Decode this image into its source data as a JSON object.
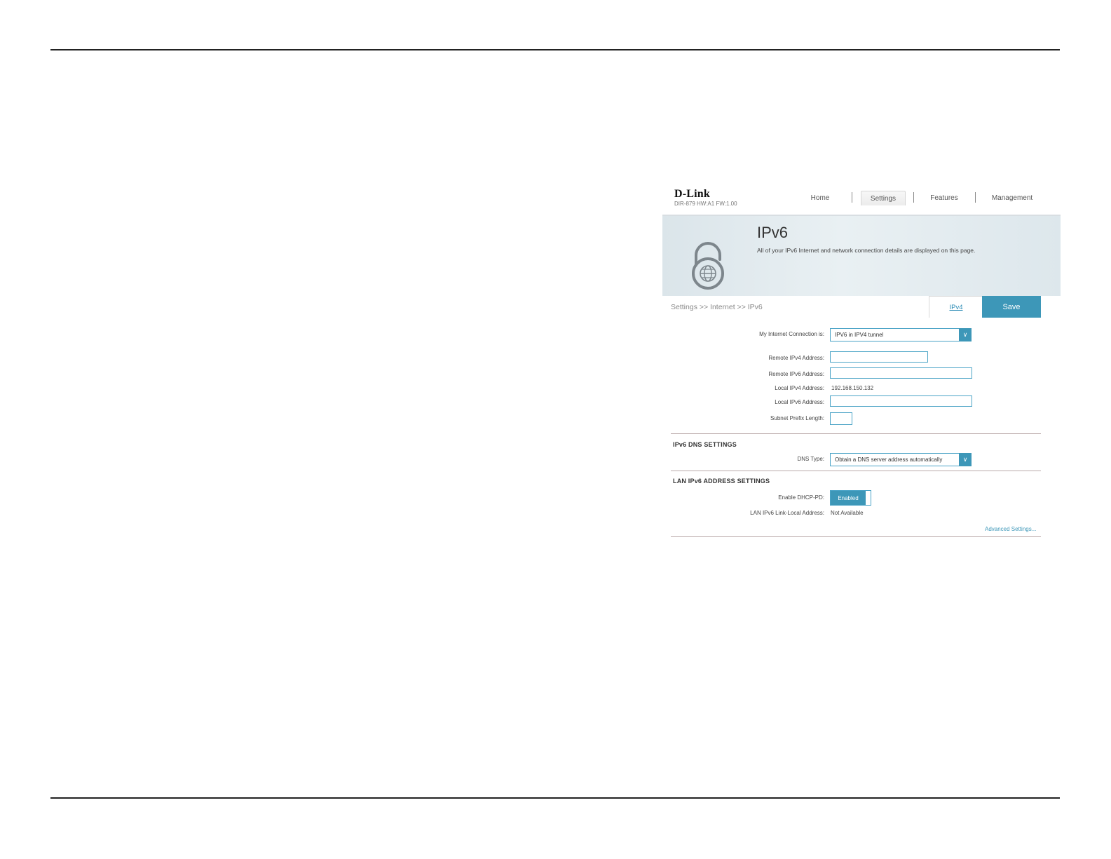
{
  "header": {
    "logo": "D-Link",
    "model": "DIR-879 HW:A1 FW:1.00",
    "nav": [
      {
        "label": "Home",
        "active": false
      },
      {
        "label": "Settings",
        "active": true
      },
      {
        "label": "Features",
        "active": false
      },
      {
        "label": "Management",
        "active": false
      }
    ]
  },
  "banner": {
    "title": "IPv6",
    "description": "All of your IPv6 Internet and network connection details are displayed on this page.",
    "icon": "ipv6-lock-globe-icon"
  },
  "subheader": {
    "breadcrumb": "Settings >> Internet >> IPv6",
    "ipv4_link": "IPv4",
    "save_label": "Save"
  },
  "connection": {
    "type_label": "My Internet Connection is:",
    "type_value": "IPV6 in IPV4 tunnel",
    "remote_ipv4_label": "Remote IPv4 Address:",
    "remote_ipv4_value": "",
    "remote_ipv6_label": "Remote IPv6 Address:",
    "remote_ipv6_value": "",
    "local_ipv4_label": "Local IPv4 Address:",
    "local_ipv4_value": "192.168.150.132",
    "local_ipv6_label": "Local IPv6 Address:",
    "local_ipv6_value": "",
    "prefix_label": "Subnet Prefix Length:",
    "prefix_value": ""
  },
  "dns": {
    "section_title": "IPv6 DNS SETTINGS",
    "type_label": "DNS Type:",
    "type_value": "Obtain a DNS server address automatically"
  },
  "lan": {
    "section_title": "LAN IPv6 ADDRESS SETTINGS",
    "dhcp_pd_label": "Enable DHCP-PD:",
    "dhcp_pd_value": "Enabled",
    "link_local_label": "LAN IPv6 Link-Local Address:",
    "link_local_value": "Not Available",
    "advanced_link": "Advanced Settings..."
  },
  "colors": {
    "accent": "#3d97b8",
    "banner": "#e3ebef"
  }
}
